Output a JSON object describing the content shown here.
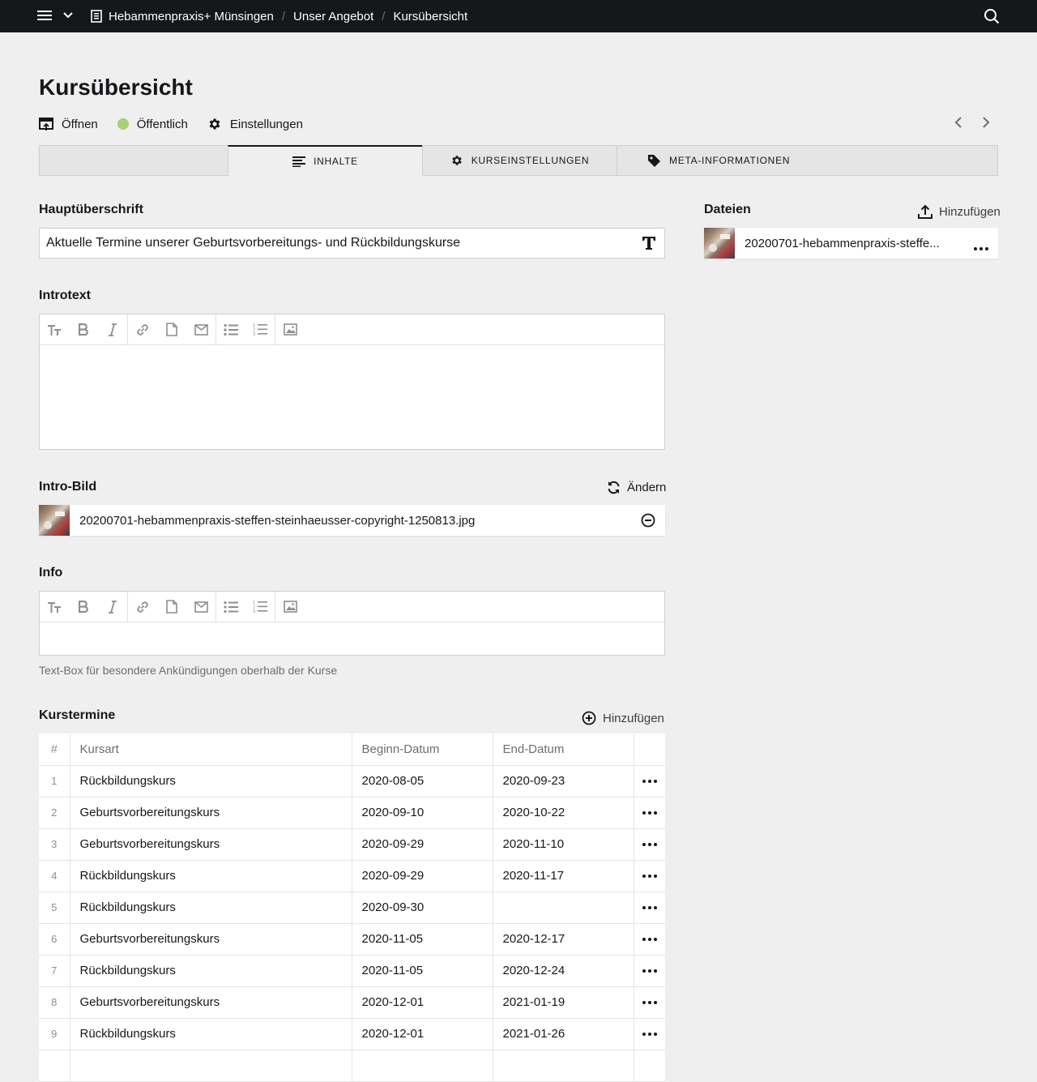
{
  "topbar": {
    "breadcrumbs": [
      "Hebammenpraxis+ Münsingen",
      "Unser Angebot",
      "Kursübersicht"
    ]
  },
  "page": {
    "title": "Kursübersicht",
    "actions": {
      "open": "Öffnen",
      "status": "Öffentlich",
      "settings": "Einstellungen"
    },
    "status_color": "#a7d077"
  },
  "tabs": [
    {
      "label": ""
    },
    {
      "label": "Inhalte",
      "icon": "lines-icon"
    },
    {
      "label": "Kurseinstellungen",
      "icon": "gear-icon"
    },
    {
      "label": "Meta-Informationen",
      "icon": "tag-icon"
    }
  ],
  "fields": {
    "headline": {
      "label": "Hauptüberschrift",
      "value": "Aktuelle Termine unserer Geburtsvorbereitungs- und Rückbildungskurse"
    },
    "introtext": {
      "label": "Introtext"
    },
    "intro_image": {
      "label": "Intro-Bild",
      "change": "Ändern",
      "file": "20200701-hebammenpraxis-steffen-steinhaeusser-copyright-1250813.jpg"
    },
    "info": {
      "label": "Info",
      "help": "Text-Box für besondere Ankündigungen oberhalb der Kurse"
    }
  },
  "files": {
    "label": "Dateien",
    "add": "Hinzufügen",
    "items": [
      "20200701-hebammenpraxis-steffe..."
    ]
  },
  "courses": {
    "label": "Kurstermine",
    "add": "Hinzufügen",
    "headers": [
      "#",
      "Kursart",
      "Beginn-Datum",
      "End-Datum"
    ],
    "rows": [
      {
        "n": "1",
        "type": "Rückbildungskurs",
        "start": "2020-08-05",
        "end": "2020-09-23"
      },
      {
        "n": "2",
        "type": "Geburtsvorbereitungskurs",
        "start": "2020-09-10",
        "end": "2020-10-22"
      },
      {
        "n": "3",
        "type": "Geburtsvorbereitungskurs",
        "start": "2020-09-29",
        "end": "2020-11-10"
      },
      {
        "n": "4",
        "type": "Rückbildungskurs",
        "start": "2020-09-29",
        "end": "2020-11-17"
      },
      {
        "n": "5",
        "type": "Rückbildungskurs",
        "start": "2020-09-30",
        "end": ""
      },
      {
        "n": "6",
        "type": "Geburtsvorbereitungskurs",
        "start": "2020-11-05",
        "end": "2020-12-17"
      },
      {
        "n": "7",
        "type": "Rückbildungskurs",
        "start": "2020-11-05",
        "end": "2020-12-24"
      },
      {
        "n": "8",
        "type": "Geburtsvorbereitungskurs",
        "start": "2020-12-01",
        "end": "2021-01-19"
      },
      {
        "n": "9",
        "type": "Rückbildungskurs",
        "start": "2020-12-01",
        "end": "2021-01-26"
      },
      {
        "n": "",
        "type": "",
        "start": "",
        "end": ""
      }
    ]
  }
}
